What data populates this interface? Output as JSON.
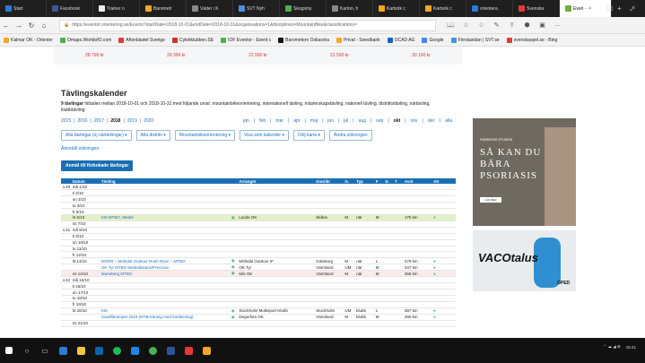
{
  "browser": {
    "tabs": [
      {
        "label": "Start",
        "color": "#2b7cd3"
      },
      {
        "label": "Facebook",
        "color": "#3b5998"
      },
      {
        "label": "Trainer o",
        "color": "#eee"
      },
      {
        "label": "Barometr",
        "color": "#f6a623"
      },
      {
        "label": "Väder i K",
        "color": "#888"
      },
      {
        "label": "SVT Nyh",
        "color": "#4a90e2"
      },
      {
        "label": "Skogsmy",
        "color": "#4caf50"
      },
      {
        "label": "Karton, h",
        "color": "#888"
      },
      {
        "label": "Kartsök c",
        "color": "#f5a623"
      },
      {
        "label": "Kartsök c",
        "color": "#f5a623"
      },
      {
        "label": "orientera",
        "color": "#2b7cd3"
      },
      {
        "label": "Svenska",
        "color": "#e53935"
      }
    ],
    "active_tab": {
      "label": "Even",
      "color": "#6fae3a",
      "close": "×",
      "new": "+",
      "dropdown": "⌄"
    },
    "window": {
      "minimize": "—",
      "maximize": "☐",
      "close": "×"
    },
    "nav": {
      "back": "←",
      "forward": "→",
      "reload": "↻",
      "home": "⌂"
    },
    "url": "https://eventor.orientering.se/Events?startDate=2018-10-01&endDate=2018-10-31&organisations=1&disciplines=MountainBike&classifications=",
    "toolbar_icons": [
      "reader-icon",
      "star-icon",
      "favorites-icon",
      "pen-icon",
      "share-icon",
      "pocket-icon",
      "adblock-icon",
      "menu-icon"
    ],
    "toolbar_glyphs": [
      "📖",
      "☆",
      "☆",
      "✎",
      "⇪",
      "⬢",
      "▣",
      "…"
    ],
    "favorites": [
      {
        "label": "Kalmar OK - Orienter",
        "color": "#f5a623"
      },
      {
        "label": "Omaps.WorldofO.com",
        "color": "#4caf50"
      },
      {
        "label": "Aftonbladet Sverige",
        "color": "#e53935"
      },
      {
        "label": "Cykelklubben.SE",
        "color": "#d32f2f"
      },
      {
        "label": "IOF Eventor - Event c",
        "color": "#4caf50"
      },
      {
        "label": "Barometern Oskarsha",
        "color": "#111"
      },
      {
        "label": "Privat - Swedbank",
        "color": "#f5a623"
      },
      {
        "label": "OCAD AG",
        "color": "#1565c0"
      },
      {
        "label": "Google",
        "color": "#4285f4"
      },
      {
        "label": "Förstasidan | SVT.se",
        "color": "#4a90e2"
      },
      {
        "label": "svenskaspel.se - Bing",
        "color": "#e53935"
      }
    ]
  },
  "strip": [
    "28 790 kr",
    "29 390 kr",
    "22 990 kr",
    "21 590 kr",
    "30 190 kr"
  ],
  "page": {
    "title": "Tävlingskalender",
    "summary_bold": "9 tävlingar",
    "summary": " hittades mellan 2018-10-01 och 2018-10-31 med följande urval: mountainbikeorientering, internationell tävling, mästerskapstävling, nationell tävling, distriktstävling, närtävling, klubbtävling.",
    "years": [
      "2015",
      "2016",
      "2017",
      "2018",
      "2019",
      "2020"
    ],
    "active_year": "2018",
    "months": [
      "jan",
      "feb",
      "mar",
      "apr",
      "maj",
      "jun",
      "jul",
      "aug",
      "sep",
      "okt",
      "nov",
      "dec",
      "alla"
    ],
    "active_month": "okt",
    "filters": [
      "Alla tävlingar (ej närtävlingar)",
      "Alla distrikt",
      "Mountainbikeorientering",
      "Visa som kalender",
      "Dölj karta",
      "Ändra sökningen"
    ],
    "reset": "Återställ sökningen",
    "register": "Anmäl till förbokade tävlingar"
  },
  "table": {
    "headers": [
      "",
      "Datum",
      "Tävling",
      "",
      "Arrangör",
      "Distrikt",
      "G.",
      "Typ",
      "F",
      "D",
      "T",
      "Avst",
      "Att"
    ],
    "rows": [
      {
        "w": "v.40",
        "d": "må 1/10",
        "n": "",
        "o": "",
        "dist": "",
        "g": "",
        "t": "",
        "f": "",
        "km": "",
        "cls": ""
      },
      {
        "w": "",
        "d": "ti 2/10",
        "n": "",
        "o": "",
        "dist": "",
        "g": "",
        "t": "",
        "f": "",
        "km": "",
        "cls": ""
      },
      {
        "w": "",
        "d": "on 3/10",
        "n": "",
        "o": "",
        "dist": "",
        "g": "",
        "t": "",
        "f": "",
        "km": "",
        "cls": ""
      },
      {
        "w": "",
        "d": "to 4/10",
        "n": "",
        "o": "",
        "dist": "",
        "g": "",
        "t": "",
        "f": "",
        "km": "",
        "cls": ""
      },
      {
        "w": "",
        "d": "fr 5/10",
        "n": "",
        "o": "",
        "dist": "",
        "g": "",
        "t": "",
        "f": "",
        "km": "",
        "cls": ""
      },
      {
        "w": "",
        "d": "lö 6/10",
        "n": "KM MTBO, Medel",
        "o": "Lunds OK",
        "dist": "Skåne",
        "g": "M",
        "t": "när",
        "f": "M",
        "km": "175 km",
        "cls": "hl"
      },
      {
        "w": "",
        "d": "sö 7/10",
        "n": "",
        "o": "",
        "dist": "",
        "g": "",
        "t": "",
        "f": "",
        "km": "",
        "cls": ""
      },
      {
        "w": "v.41",
        "d": "må 8/10",
        "n": "",
        "o": "",
        "dist": "",
        "g": "",
        "t": "",
        "f": "",
        "km": "",
        "cls": ""
      },
      {
        "w": "",
        "d": "ti 9/10",
        "n": "",
        "o": "",
        "dist": "",
        "g": "",
        "t": "",
        "f": "",
        "km": "",
        "cls": ""
      },
      {
        "w": "",
        "d": "on 10/10",
        "n": "",
        "o": "",
        "dist": "",
        "g": "",
        "t": "",
        "f": "",
        "km": "",
        "cls": ""
      },
      {
        "w": "",
        "d": "to 11/10",
        "n": "",
        "o": "",
        "dist": "",
        "g": "",
        "t": "",
        "f": "",
        "km": "",
        "cls": ""
      },
      {
        "w": "",
        "d": "fr 12/10",
        "n": "",
        "o": "",
        "dist": "",
        "g": "",
        "t": "",
        "f": "",
        "km": "",
        "cls": ""
      },
      {
        "w": "",
        "d": "lö 13/10",
        "n": "MORR – Mölndal Outdoor Rush Race – MTBO",
        "o": "Mölndal Outdoor IF",
        "dist": "Göteborg",
        "g": "M",
        "t": "när",
        "f": "L",
        "km": "279 km",
        "cls": ""
      },
      {
        "w": "",
        "d": "",
        "n": "OK Tyr MTBO Medeldistans/Precision",
        "o": "OK Tyr",
        "dist": "Värmland",
        "g": "UM",
        "t": "när",
        "f": "M",
        "km": "347 km",
        "cls": ""
      },
      {
        "w": "",
        "d": "sö 14/10",
        "n": "Marieberg MTBO",
        "o": "Kils OK",
        "dist": "Värmland",
        "g": "M",
        "t": "när",
        "f": "M",
        "km": "368 km",
        "cls": "red"
      },
      {
        "w": "v.42",
        "d": "må 15/10",
        "n": "",
        "o": "",
        "dist": "",
        "g": "",
        "t": "",
        "f": "",
        "km": "",
        "cls": ""
      },
      {
        "w": "",
        "d": "ti 16/10",
        "n": "",
        "o": "",
        "dist": "",
        "g": "",
        "t": "",
        "f": "",
        "km": "",
        "cls": ""
      },
      {
        "w": "",
        "d": "on 17/10",
        "n": "",
        "o": "",
        "dist": "",
        "g": "",
        "t": "",
        "f": "",
        "km": "",
        "cls": ""
      },
      {
        "w": "",
        "d": "to 18/10",
        "n": "",
        "o": "",
        "dist": "",
        "g": "",
        "t": "",
        "f": "",
        "km": "",
        "cls": ""
      },
      {
        "w": "",
        "d": "fr 19/10",
        "n": "",
        "o": "",
        "dist": "",
        "g": "",
        "t": "",
        "f": "",
        "km": "",
        "cls": ""
      },
      {
        "w": "",
        "d": "lö 20/10",
        "n": "KM",
        "o": "Stockholm Multisport Klubb",
        "dist": "Stockholm",
        "g": "UM",
        "t": "klubb",
        "f": "L",
        "km": "387 km",
        "cls": ""
      },
      {
        "w": "",
        "d": "",
        "n": "Svartåkrampet 2018 (MTB-träning med kartläsning)",
        "o": "Degerfors OK",
        "dist": "Värmland",
        "g": "M",
        "t": "klubb",
        "f": "M",
        "km": "290 km",
        "cls": ""
      },
      {
        "w": "",
        "d": "sö 21/10",
        "n": "",
        "o": "",
        "dist": "",
        "g": "",
        "t": "",
        "f": "",
        "km": "",
        "cls": ""
      }
    ]
  },
  "ads": {
    "psor_small": "FABRIKENS STUDIOS",
    "psor": "SÅ KAN DU BÄRA PSORIASIS",
    "psor_btn": "LÄS MER",
    "vaco": "VACOtalus",
    "brand": "OPED"
  },
  "taskbar": {
    "time": "15:41",
    "date": "2018-..."
  }
}
